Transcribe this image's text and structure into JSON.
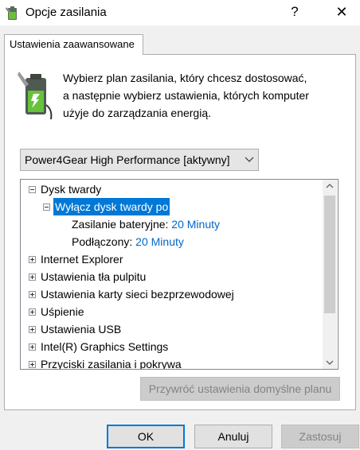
{
  "window": {
    "title": "Opcje zasilania",
    "help_glyph": "?",
    "close_glyph": "✕"
  },
  "tab": {
    "label": "Ustawienia zaawansowane"
  },
  "description": {
    "line1": "Wybierz plan zasilania, który chcesz dostosować,",
    "line2": "a następnie wybierz ustawienia, których komputer",
    "line3": "użyje do zarządzania energią."
  },
  "plan_select": {
    "value": "Power4Gear High Performance [aktywny]"
  },
  "tree": {
    "dysk": "Dysk twardy",
    "wylacz": "Wyłącz dysk twardy po",
    "bateria_label": "Zasilanie bateryjne:",
    "bateria_value": "20 Minuty",
    "podlaczony_label": "Podłączony:",
    "podlaczony_value": "20 Minuty",
    "ie": "Internet Explorer",
    "tlo": "Ustawienia tła pulpitu",
    "wifi": "Ustawienia karty sieci bezprzewodowej",
    "uspienie": "Uśpienie",
    "usb": "Ustawienia USB",
    "intel": "Intel(R) Graphics Settings",
    "przyciski": "Przyciski zasilania i pokrywa"
  },
  "buttons": {
    "restore": "Przywróć ustawienia domyślne planu",
    "ok": "OK",
    "cancel": "Anuluj",
    "apply": "Zastosuj"
  },
  "colors": {
    "selection": "#0078d7",
    "link": "#0066cc",
    "disabled_text": "#838383"
  }
}
